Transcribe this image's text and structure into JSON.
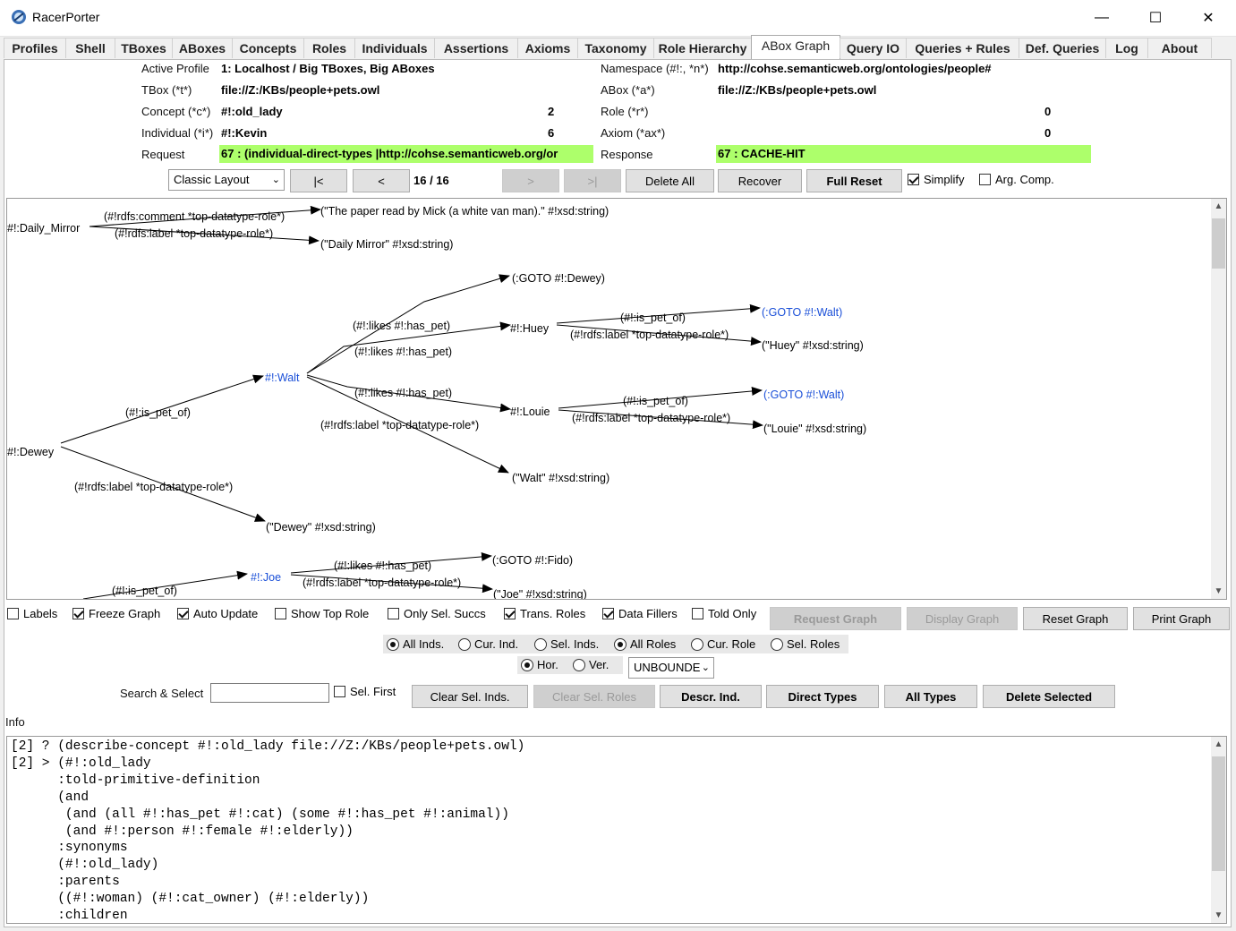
{
  "window": {
    "title": "RacerPorter",
    "minimize": "—",
    "maximize": "☐",
    "close": "✕"
  },
  "tabs": [
    "Profiles",
    "Shell",
    "TBoxes",
    "ABoxes",
    "Concepts",
    "Roles",
    "Individuals",
    "Assertions",
    "Axioms",
    "Taxonomy",
    "Role Hierarchy",
    "ABox Graph",
    "Query IO",
    "Queries + Rules",
    "Def. Queries",
    "Log",
    "About"
  ],
  "active_tab": "ABox Graph",
  "status": {
    "active_profile_label": "Active Profile",
    "active_profile_value": "1: Localhost / Big TBoxes, Big ABoxes",
    "namespace_label": "Namespace (#!:, *n*)",
    "namespace_value": "http://cohse.semanticweb.org/ontologies/people#",
    "tbox_label": "TBox (*t*)",
    "tbox_value": "file://Z:/KBs/people+pets.owl",
    "abox_label": "ABox (*a*)",
    "abox_value": "file://Z:/KBs/people+pets.owl",
    "concept_label": "Concept (*c*)",
    "concept_value": "#!:old_lady",
    "concept_count": "2",
    "role_label": "Role (*r*)",
    "role_count": "0",
    "individual_label": "Individual (*i*)",
    "individual_value": "#!:Kevin",
    "individual_count": "6",
    "axiom_label": "Axiom (*ax*)",
    "axiom_count": "0",
    "request_label": "Request",
    "request_value": "67 : (individual-direct-types |http://cohse.semanticweb.org/or",
    "response_label": "Response",
    "response_value": "67 : CACHE-HIT"
  },
  "toolbar": {
    "layout_select": "Classic Layout",
    "first": "|<",
    "prev": "<",
    "page": "16 / 16",
    "next": ">",
    "last": ">|",
    "delete_all": "Delete All",
    "recover": "Recover",
    "full_reset": "Full Reset",
    "simplify": "Simplify",
    "arg_comp": "Arg. Comp."
  },
  "graph": {
    "nodes": {
      "daily_mirror": "#!:Daily_Mirror",
      "dm_comment_edge": "(#!rdfs:comment *top-datatype-role*)",
      "dm_comment_val": "(\"The paper read by Mick (a white van man).\" #!xsd:string)",
      "dm_label_edge": "(#!rdfs:label *top-datatype-role*)",
      "dm_label_val": "(\"Daily Mirror\" #!xsd:string)",
      "goto_dewey": "(:GOTO #!:Dewey)",
      "likes1": "(#!:likes #!:has_pet)",
      "likes2": "(#!:likes #!:has_pet)",
      "likes3": "(#!:likes #!:has_pet)",
      "huey": "#!:Huey",
      "huey_petof": "(#!:is_pet_of)",
      "huey_goto": "(:GOTO #!:Walt)",
      "huey_label_edge": "(#!rdfs:label *top-datatype-role*)",
      "huey_label_val": "(\"Huey\" #!xsd:string)",
      "walt": "#!:Walt",
      "walt_label_edge": "(#!rdfs:label *top-datatype-role*)",
      "walt_label_val": "(\"Walt\" #!xsd:string)",
      "louie": "#!:Louie",
      "louie_petof": "(#!:is_pet_of)",
      "louie_goto": "(:GOTO #!:Walt)",
      "louie_label_edge": "(#!rdfs:label *top-datatype-role*)",
      "louie_label_val": "(\"Louie\" #!xsd:string)",
      "dewey": "#!:Dewey",
      "dewey_petof": "(#!:is_pet_of)",
      "dewey_label_edge": "(#!rdfs:label *top-datatype-role*)",
      "dewey_label_val": "(\"Dewey\" #!xsd:string)",
      "joe": "#!:Joe",
      "joe_likes": "(#!:likes #!:has_pet)",
      "joe_goto": "(:GOTO #!:Fido)",
      "joe_label_edge": "(#!rdfs:label *top-datatype-role*)",
      "joe_label_val": "(\"Joe\" #!xsd:string)",
      "bottom_petof": "(#!:is_pet_of)"
    },
    "link_color": "#1a4fd8"
  },
  "options": {
    "labels": "Labels",
    "freeze_graph": "Freeze Graph",
    "auto_update": "Auto Update",
    "show_top_role": "Show Top Role",
    "only_sel_succs": "Only Sel. Succs",
    "trans_roles": "Trans. Roles",
    "data_fillers": "Data Fillers",
    "told_only": "Told Only",
    "request_graph": "Request Graph",
    "display_graph": "Display Graph",
    "reset_graph": "Reset Graph",
    "print_graph": "Print Graph",
    "all_inds": "All Inds.",
    "cur_ind": "Cur. Ind.",
    "sel_inds": "Sel. Inds.",
    "all_roles": "All Roles",
    "cur_role": "Cur. Role",
    "sel_roles": "Sel. Roles",
    "hor": "Hor.",
    "ver": "Ver.",
    "depth_select": "UNBOUNDE",
    "search_label": "Search & Select",
    "search_value": "",
    "sel_first": "Sel. First",
    "clear_sel_inds": "Clear Sel. Inds.",
    "clear_sel_roles": "Clear Sel. Roles",
    "descr_ind": "Descr. Ind.",
    "direct_types": "Direct Types",
    "all_types": "All Types",
    "delete_selected": "Delete Selected"
  },
  "info": {
    "label": "Info",
    "text": "[2] ? (describe-concept #!:old_lady file://Z:/KBs/people+pets.owl)\n[2] > (#!:old_lady\n      :told-primitive-definition\n      (and\n       (and (all #!:has_pet #!:cat) (some #!:has_pet #!:animal))\n       (and #!:person #!:female #!:elderly))\n      :synonyms\n      (#!:old_lady)\n      :parents\n      ((#!:woman) (#!:cat_owner) (#!:elderly))\n      :children"
  }
}
